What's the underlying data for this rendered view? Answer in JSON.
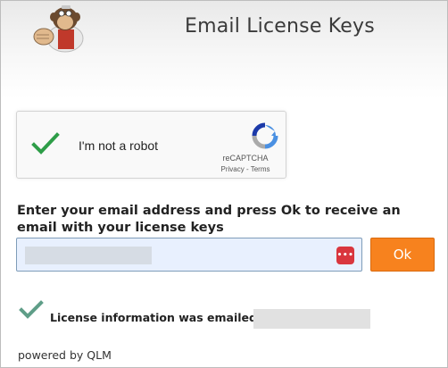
{
  "header": {
    "title": "Email License Keys",
    "logo_icon": "monkey-mascot-icon"
  },
  "recaptcha": {
    "label": "I'm not a robot",
    "checked": true,
    "brand": "reCAPTCHA",
    "links": "Privacy - Terms",
    "check_color": "#2e9d48",
    "logo_icon": "recaptcha-logo-icon"
  },
  "form": {
    "instruction": "Enter your email address and press Ok to receive an email with your license keys",
    "email_value": "",
    "autofill_icon": "password-manager-icon",
    "ok_label": "Ok",
    "ok_color": "#f7821e"
  },
  "status": {
    "message": "License information was emailed to:",
    "check_color": "#5f9e88"
  },
  "footer": {
    "text": "powered by QLM"
  }
}
